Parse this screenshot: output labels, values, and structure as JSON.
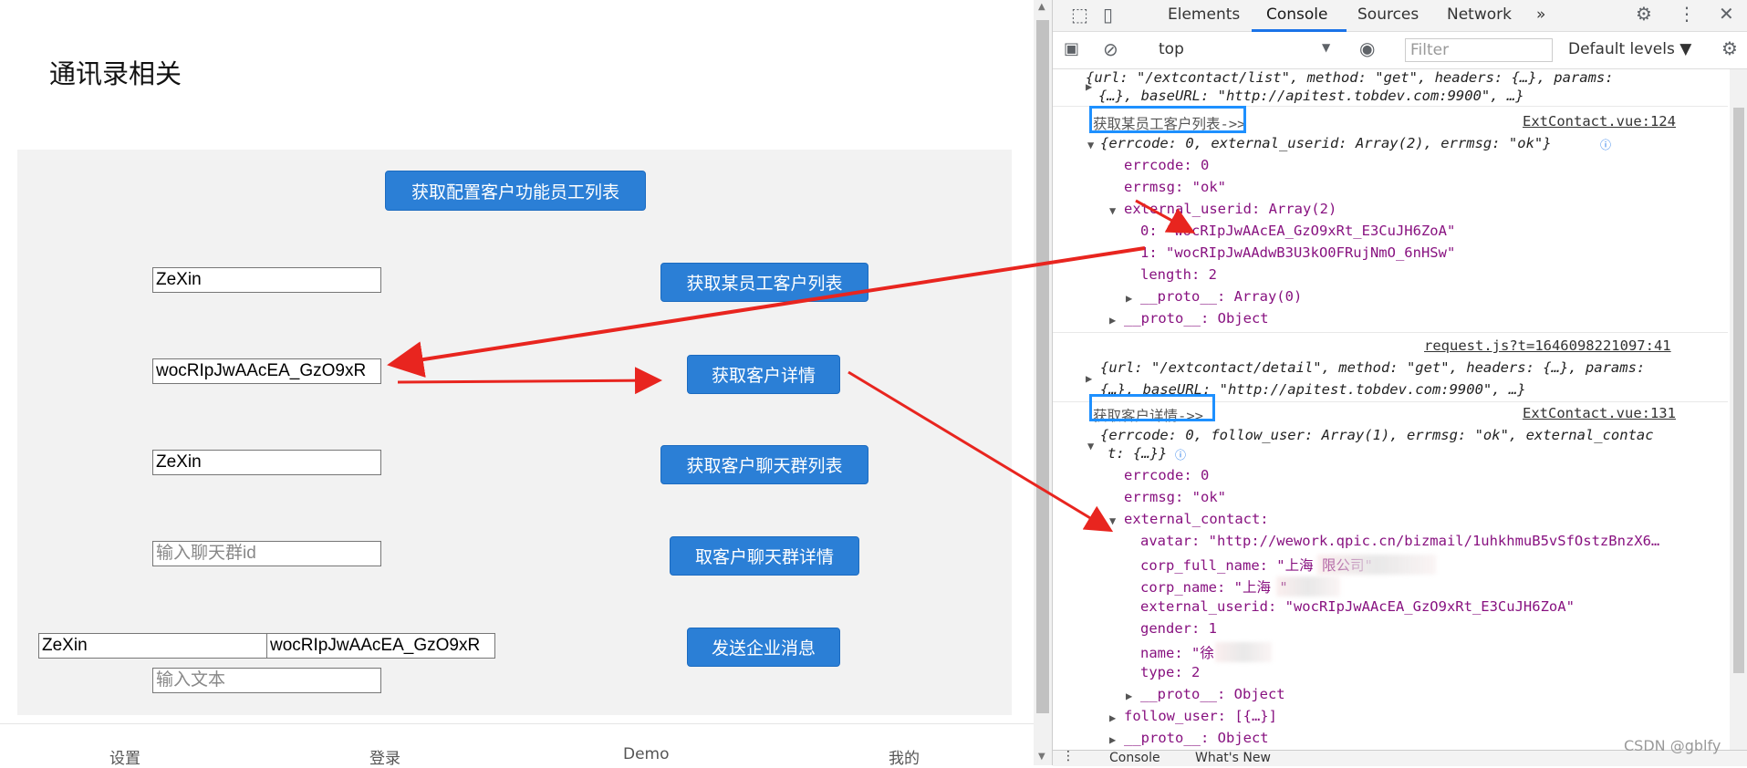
{
  "app": {
    "title": "通讯录相关",
    "buttons": {
      "config_staff": "获取配置客户功能员工列表",
      "staff_customers": "获取某员工客户列表",
      "customer_detail": "获取客户详情",
      "group_list": "获取客户聊天群列表",
      "group_detail": "取客户聊天群详情",
      "send_message": "发送企业消息"
    },
    "inputs": {
      "user1": "ZeXin",
      "external_id": "wocRIpJwAAcEA_GzO9xR",
      "user2": "ZeXin",
      "group_id_placeholder": "输入聊天群id",
      "msg_user": "ZeXin",
      "msg_external": "wocRIpJwAAcEA_GzO9xR",
      "text_placeholder": "输入文本"
    },
    "tabbar": [
      "设置",
      "登录",
      "Demo",
      "我的"
    ]
  },
  "devtools": {
    "tabs": [
      "Elements",
      "Console",
      "Sources",
      "Network"
    ],
    "active_tab": "Console",
    "more": "»",
    "context": "top",
    "filter_placeholder": "Filter",
    "levels": "Default levels ▼",
    "console": {
      "l1a": "{url: \"/extcontact/list\", method: \"get\", headers: {…}, params:",
      "l1b": "{…}, baseURL: \"http://apitest.tobdev.com:9900\", …}",
      "log1": "获取某员工客户列表->>",
      "src1": "ExtContact.vue:124",
      "obj1": "{errcode: 0, external_userid: Array(2), errmsg: \"ok\"}",
      "errcode": "errcode: 0",
      "errmsg": "errmsg: \"ok\"",
      "ext_userid": "external_userid: Array(2)",
      "id0": "0: \"wocRIpJwAAcEA_GzO9xRt_E3CuJH6ZoA\"",
      "id1": "1: \"wocRIpJwAAdwB3U3kO0FRujNmO_6nHSw\"",
      "length": "length: 2",
      "proto_arr": "__proto__: Array(0)",
      "proto_obj": "__proto__: Object",
      "src2": "request.js?t=1646098221097:41",
      "l2a": "{url: \"/extcontact/detail\", method: \"get\", headers: {…}, params:",
      "l2b": "{…}, baseURL: \"http://apitest.tobdev.com:9900\", …}",
      "log2": "获取客户详情->>",
      "src3": "ExtContact.vue:131",
      "obj2a": "{errcode: 0, follow_user: Array(1), errmsg: \"ok\", external_contac",
      "obj2b": "t: {…}}",
      "errcode2": "errcode: 0",
      "errmsg2": "errmsg: \"ok\"",
      "ext_contact": "external_contact:",
      "avatar": "avatar: \"http://wework.qpic.cn/bizmail/1uhkhmuB5vSfOstzBnzX6…",
      "corp_full": "corp_full_name: \"上海                    限公司\"",
      "corp_name": "corp_name: \"上海      \"",
      "ext_uid": "external_userid: \"wocRIpJwAAcEA_GzO9xRt_E3CuJH6ZoA\"",
      "gender": "gender: 1",
      "name": "name: \"徐      ",
      "type": "type: 2",
      "proto3": "__proto__: Object",
      "follow_user": "follow_user: [{…}]",
      "proto4": "__proto__: Object"
    },
    "drawer_tabs": [
      "Console",
      "What's New"
    ],
    "watermark": "CSDN @gblfy"
  }
}
